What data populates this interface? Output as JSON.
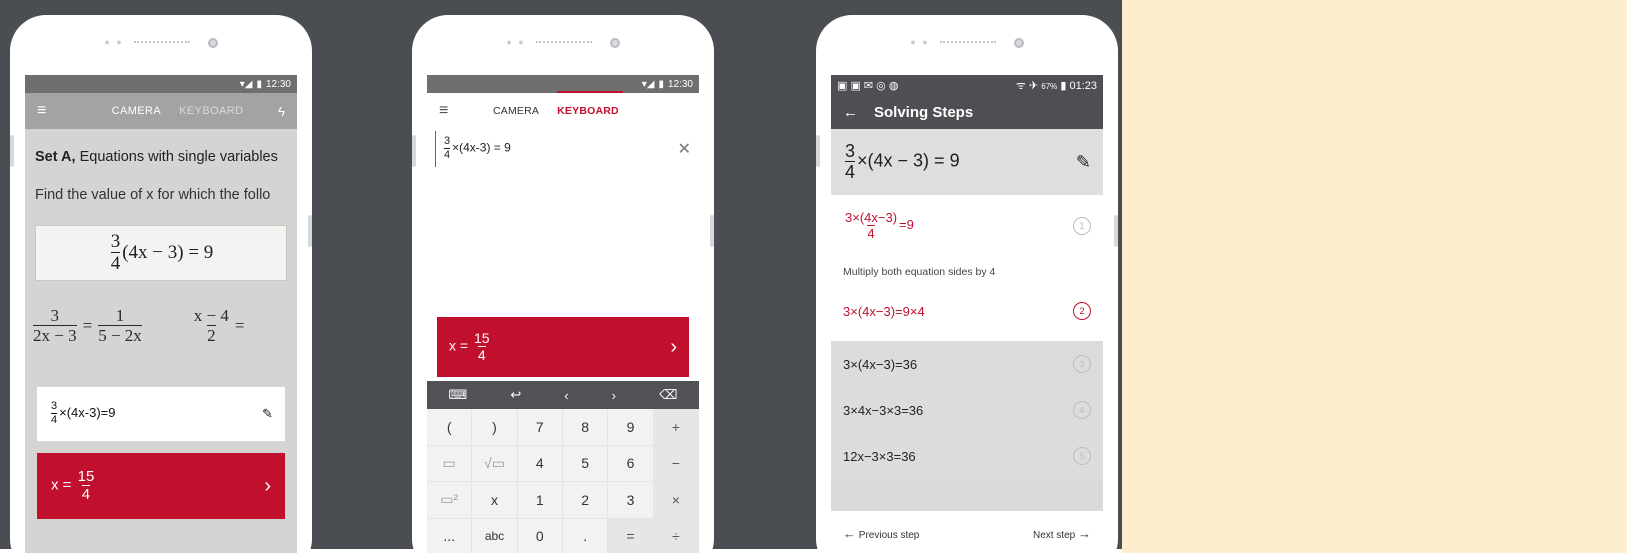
{
  "phone1": {
    "status_time": "12:30",
    "tabs": [
      "CAMERA",
      "KEYBOARD"
    ],
    "set_bold": "Set A,",
    "set_rest": " Equations with single variables",
    "find_text": "Find the value of x for which the follo",
    "scan_eq": {
      "num": "3",
      "den": "4",
      "rest": "(4x − 3) = 9"
    },
    "row_eq1": {
      "num": "3",
      "den": "2x − 3"
    },
    "row_eq2": {
      "num": "1",
      "den": "5 − 2x"
    },
    "row_eq3": {
      "num": "x − 4",
      "den": "2"
    },
    "equals": "=",
    "card_eq": {
      "num": "3",
      "den": "4",
      "rest": "×(4x-3)=9"
    },
    "answer": {
      "prefix": "x =",
      "num": "15",
      "den": "4"
    }
  },
  "phone2": {
    "status_time": "12:30",
    "tabs": [
      "CAMERA",
      "KEYBOARD"
    ],
    "input": {
      "num": "3",
      "den": "4",
      "rest": "×(4x-3) = 9"
    },
    "answer": {
      "prefix": "x =",
      "num": "15",
      "den": "4"
    },
    "toolbar": [
      "⌨",
      "↩",
      "‹",
      "›",
      "⌫"
    ],
    "keys": [
      "(",
      ")",
      "7",
      "8",
      "9",
      "+",
      "▭",
      "√▭",
      "4",
      "5",
      "6",
      "−",
      "▭²",
      "x",
      "1",
      "2",
      "3",
      "×",
      "...",
      "abc",
      "0",
      ".",
      "=",
      "÷"
    ]
  },
  "phone3": {
    "status_battery": "67%",
    "status_time": "01:23",
    "title": "Solving Steps",
    "problem": {
      "num": "3",
      "den": "4",
      "rest": "×(4x − 3) = 9"
    },
    "step1": {
      "num": "3×(4x−3)",
      "den": "4",
      "rest": "=9",
      "n": "1"
    },
    "hint": "Multiply both equation sides by 4",
    "step2": {
      "text": "3×(4x−3)=9×4",
      "n": "2"
    },
    "step3": {
      "text": "3×(4x−3)=36",
      "n": "3"
    },
    "step4": {
      "text": "3×4x−3×3=36",
      "n": "4"
    },
    "step5": {
      "text": "12x−3×3=36",
      "n": "5"
    },
    "prev": "Previous step",
    "next": "Next step"
  }
}
